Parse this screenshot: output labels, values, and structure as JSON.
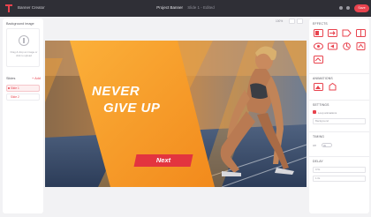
{
  "topbar": {
    "app_title": "Banner Creator",
    "project_title": "Project Banner",
    "project_subtitle": "Slide 1 - Edited",
    "save_label": "Save"
  },
  "left_panel": {
    "heading": "Background image",
    "upload_text": "Drag & drop an image or click to upload",
    "pages_heading": "Slides",
    "add_label": "+ Add",
    "pages": [
      "Slide 1",
      "Slide 2"
    ]
  },
  "canvas": {
    "zoom": "100%",
    "slide": {
      "line1": "NEVER",
      "line2": "GIVE UP",
      "button_label": "Next"
    }
  },
  "right_panel": {
    "effects_title": "EFFECTS",
    "animations_title": "ANIMATIONS",
    "settings_title": "SETTINGS",
    "setting_checkbox": "Loop animations",
    "setting_field": "Background",
    "timing_title": "TIMING",
    "timing_value": "Off",
    "delay_title": "DELAY",
    "delay_value": "0.5s",
    "duration_value": "1.0s"
  },
  "colors": {
    "accent": "#e8434e",
    "topbar": "#2f2f36",
    "slide_orange": "#f59b22",
    "button_red": "#e3343f"
  }
}
